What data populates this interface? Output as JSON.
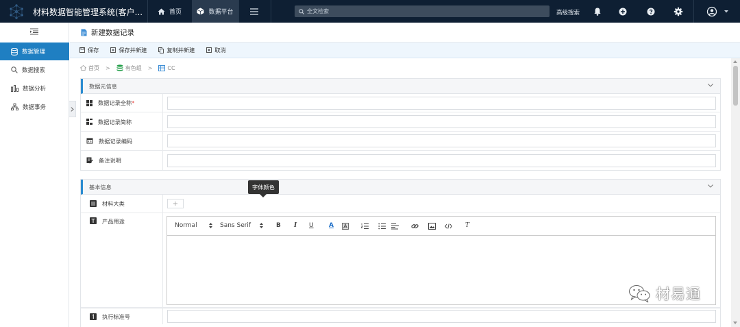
{
  "app": {
    "title": "材料数据智能管理系统(客户..."
  },
  "topnav": {
    "home": "首页",
    "platform": "数据平台",
    "advanced_search": "高级搜索"
  },
  "search": {
    "placeholder": "全文检索"
  },
  "top_icons": [
    "bell-icon",
    "plus-circle-icon",
    "help-circle-icon",
    "gear-icon",
    "user-avatar-icon",
    "chevron-down-icon"
  ],
  "sidebar": {
    "items": [
      {
        "label": "数据管理",
        "icon": "database-icon",
        "active": true
      },
      {
        "label": "数据搜索",
        "icon": "search-icon",
        "active": false
      },
      {
        "label": "数据分析",
        "icon": "bar-chart-icon",
        "active": false
      },
      {
        "label": "数据事务",
        "icon": "org-tree-icon",
        "active": false
      }
    ]
  },
  "page": {
    "title": "新建数据记录"
  },
  "toolbar": {
    "save": "保存",
    "save_new": "保存并新建",
    "copy_new": "复制并新建",
    "cancel": "取消"
  },
  "breadcrumb": [
    "首页",
    "有色组",
    "CC"
  ],
  "meta_section": {
    "title": "数据元信息",
    "fields": [
      {
        "label": "数据记录全称",
        "required": "*"
      },
      {
        "label": "数据记录简称"
      },
      {
        "label": "数据记录编码"
      },
      {
        "label": "备注说明"
      }
    ]
  },
  "basic_section": {
    "title": "基本信息",
    "fields": [
      {
        "label": "材料大类"
      },
      {
        "label": "产品用途"
      },
      {
        "label": "执行标准号"
      }
    ]
  },
  "editor": {
    "format": "Normal",
    "font": "Sans Serif",
    "bold": "B",
    "italic": "I",
    "underline": "U",
    "color": "A",
    "clean": "T"
  },
  "tooltip": {
    "text": "字体颜色"
  },
  "add_button": "+",
  "watermark": {
    "text": "材易通"
  },
  "colors": {
    "topbar": "#0e1f33",
    "accent": "#1f7fc2",
    "section_bar": "#2a8bd1",
    "required": "#e53935"
  }
}
